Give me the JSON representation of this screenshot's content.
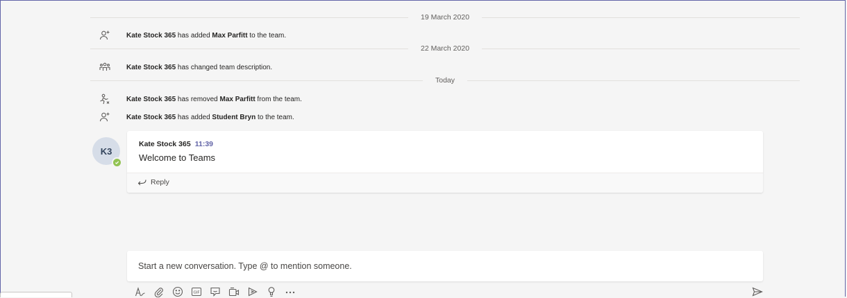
{
  "timeline": {
    "dividers": [
      "19 March 2020",
      "22 March 2020",
      "Today"
    ],
    "events": [
      {
        "icon": "person-add-icon",
        "actor": "Kate Stock 365",
        "pre": " has added ",
        "target": "Max Parfitt",
        "post": " to the team."
      },
      {
        "icon": "team-icon",
        "actor": "Kate Stock 365",
        "pre": " has changed team description.",
        "target": "",
        "post": ""
      },
      {
        "icon": "person-leave-icon",
        "actor": "Kate Stock 365",
        "pre": " has removed ",
        "target": "Max Parfitt",
        "post": " from the team."
      },
      {
        "icon": "person-add-icon",
        "actor": "Kate Stock 365",
        "pre": " has added ",
        "target": "Student Bryn",
        "post": " to the team."
      }
    ]
  },
  "message": {
    "avatar_initials": "K3",
    "author": "Kate Stock 365",
    "time": "11:39",
    "text": "Welcome to Teams",
    "reply_label": "Reply",
    "presence": "available"
  },
  "compose": {
    "placeholder": "Start a new conversation. Type @ to mention someone."
  },
  "toolbar": {
    "tools": [
      "format-icon",
      "attach-icon",
      "emoji-icon",
      "gif-icon",
      "sticker-icon",
      "meet-now-icon",
      "stream-icon",
      "praise-icon",
      "more-options-icon"
    ],
    "send": "send-icon"
  },
  "colors": {
    "accent": "#6264a7",
    "presence_green": "#92c353",
    "background": "#f5f5f5"
  }
}
